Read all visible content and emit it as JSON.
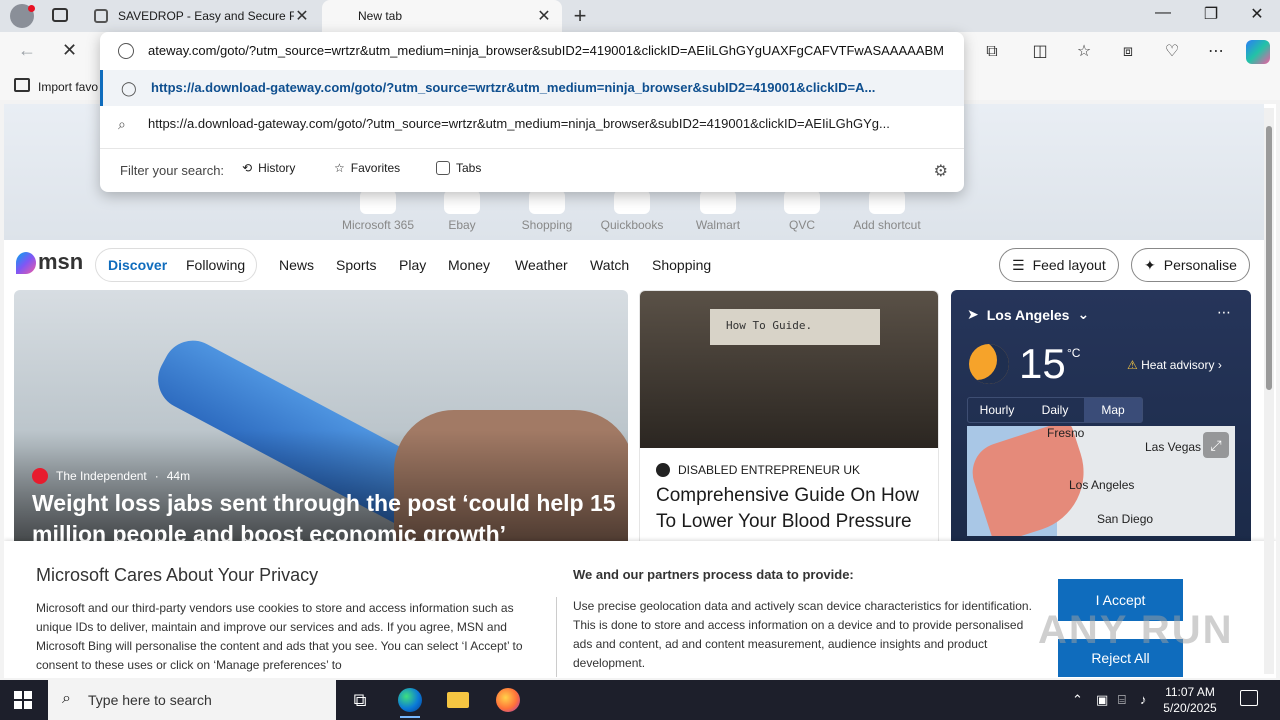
{
  "browser": {
    "tabs": [
      {
        "label": "SAVEDROP - Easy and Secure File",
        "close": "✕"
      },
      {
        "label": "New tab",
        "close": "✕"
      }
    ],
    "new_tab": "+",
    "window_controls": {
      "minimize": "—",
      "maximize": "❐",
      "close": "✕"
    },
    "favorites_bar": {
      "import_label": "Import favo"
    },
    "toolbar_icons": [
      "extensions-icon",
      "split-screen-icon",
      "favorites-icon",
      "collections-icon",
      "performance-icon",
      "more-icon",
      "copilot-icon"
    ]
  },
  "omnibox": {
    "value": "https://a.download-gateway.com/goto/?utm_source=wrtzr&utm_medium=ninja_browser&subID2=419001&clickID=AEIiLGhGYgUAXFgCAFVTFwASAAAAABM",
    "suggestions": [
      {
        "text": "https://a.download-gateway.com/goto/?utm_source=wrtzr&utm_medium=ninja_browser&subID2=419001&clickID=A...",
        "type": "url"
      },
      {
        "text": "https://a.download-gateway.com/goto/?utm_source=wrtzr&utm_medium=ninja_browser&subID2=419001&clickID=AEIiLGhGYg...",
        "type": "search"
      }
    ],
    "filter_label": "Filter your search:",
    "filters": [
      "History",
      "Favorites",
      "Tabs"
    ]
  },
  "shortcuts": [
    "Microsoft 365",
    "Ebay",
    "Shopping",
    "Quickbooks",
    "Walmart",
    "QVC",
    "Add shortcut"
  ],
  "msn": {
    "logo": "msn",
    "pills": [
      "Discover",
      "Following"
    ],
    "nav": [
      "News",
      "Sports",
      "Play",
      "Money",
      "Weather",
      "Watch",
      "Shopping"
    ],
    "feed_layout": "Feed layout",
    "personalise": "Personalise"
  },
  "cards": {
    "main": {
      "source": "The Independent",
      "age": "44m",
      "headline": "Weight loss jabs sent through the post ‘could help 15 million people and boost economic growth’"
    },
    "side": {
      "image_text": "How To Guide.",
      "source": "DISABLED ENTREPRENEUR UK",
      "headline": "Comprehensive Guide On How To Lower Your Blood Pressure"
    },
    "weather": {
      "location": "Los Angeles",
      "temperature": "15",
      "unit": "°C",
      "alert": "Heat advisory",
      "tabs": [
        "Hourly",
        "Daily",
        "Map"
      ],
      "active_tab": "Map",
      "map_cities": [
        "Fresno",
        "Las Vegas",
        "Los Angeles",
        "San Diego"
      ]
    }
  },
  "privacy": {
    "title": "Microsoft Cares About Your Privacy",
    "body": "Microsoft and our third-party vendors use cookies to store and access information such as unique IDs to deliver, maintain and improve our services and ads. If you agree, MSN and Microsoft Bing will personalise the content and ads that you see. You can select ‘I Accept’ to consent to these uses or click on ‘Manage preferences’ to",
    "subtitle": "We and our partners process data to provide:",
    "body2": "Use precise geolocation data and actively scan device characteristics for identification. This is done to store and access information on a device and to provide personalised ads and content, ad and content measurement, audience insights and product development.",
    "accept": "I Accept",
    "reject": "Reject All"
  },
  "watermark": "ANY RUN",
  "taskbar": {
    "search_placeholder": "Type here to search",
    "time": "11:07 AM",
    "date": "5/20/2025"
  }
}
